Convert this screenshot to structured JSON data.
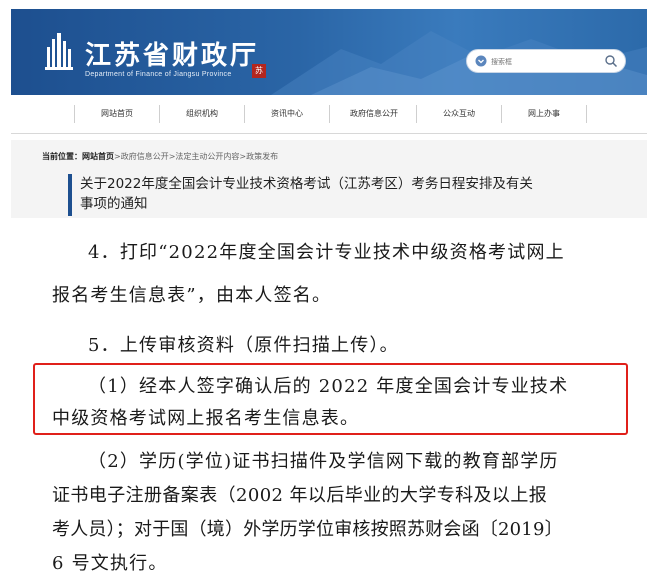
{
  "header": {
    "site_title": "江苏省财政厅",
    "site_subtitle": "Department of Finance of Jiangsu Province",
    "seal_text": "苏",
    "search_placeholder": "搜索框",
    "brand_color": "#1d4f8f"
  },
  "nav": {
    "items": [
      {
        "label": "网站首页"
      },
      {
        "label": "组织机构"
      },
      {
        "label": "资讯中心"
      },
      {
        "label": "政府信息公开"
      },
      {
        "label": "公众互动"
      },
      {
        "label": "网上办事"
      }
    ]
  },
  "breadcrumb": {
    "prefix": "当前位置：",
    "items": [
      "网站首页",
      "政府信息公开",
      "法定主动公开内容",
      "政策发布"
    ],
    "separator": ">"
  },
  "article": {
    "title_line1": "关于2022年度全国会计专业技术资格考试（江苏考区）考务日程安排及有关",
    "title_line2": "事项的通知"
  },
  "body": {
    "p4_line1": "4．打印“2022年度全国会计专业技术中级资格考试网上",
    "p4_line2": "报名考生信息表”，由本人签名。",
    "p5": "5．上传审核资料（原件扫描上传）。",
    "p5_1_line1": "（1）经本人签字确认后的 2022 年度全国会计专业技术",
    "p5_1_line2": "中级资格考试网上报名考生信息表。",
    "p5_2_line1": "（2）学历(学位)证书扫描件及学信网下载的教育部学历",
    "p5_2_line2": "证书电子注册备案表（2002 年以后毕业的大学专科及以上报",
    "p5_2_line3": "考人员）；对于国（境）外学历学位审核按照苏财会函〔2019〕",
    "p5_2_line4": "6 号文执行。"
  },
  "highlight_color": "#e0201a"
}
